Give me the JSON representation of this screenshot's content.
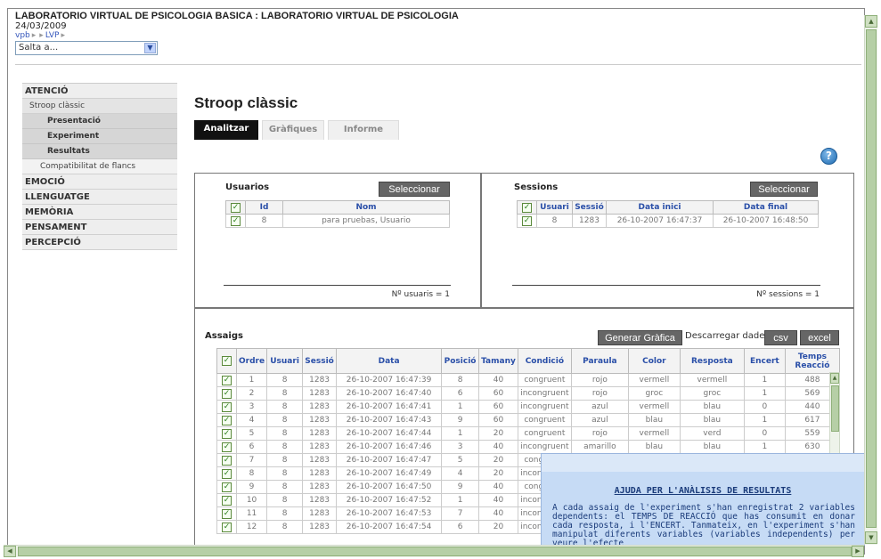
{
  "header": {
    "title": "LABORATORIO VIRTUAL DE PSICOLOGIA BASICA : LABORATORIO VIRTUAL DE PSICOLOGIA",
    "date": "24/03/2009",
    "breadcrumb": [
      "vpb",
      "LVP"
    ],
    "jump_label": "Salta a..."
  },
  "sidebar": {
    "categories": [
      {
        "label": "ATENCIÓ"
      },
      {
        "label": "EMOCIÓ"
      },
      {
        "label": "LLENGUATGE"
      },
      {
        "label": "MEMÒRIA"
      },
      {
        "label": "PENSAMENT"
      },
      {
        "label": "PERCEPCIÓ"
      }
    ],
    "atencio_sub": "Stroop clàssic",
    "atencio_leaves": [
      "Presentació",
      "Experiment",
      "Resultats"
    ],
    "atencio_sub2": "Compatibilitat de flancs"
  },
  "main": {
    "title": "Stroop clàssic",
    "tabs": [
      "Analitzar",
      "Gràfiques",
      "Informe"
    ]
  },
  "usuarios": {
    "title": "Usuarios",
    "select_label": "Seleccionar",
    "headers": [
      "Id",
      "Nom"
    ],
    "rows": [
      [
        "8",
        "para pruebas, Usuario"
      ]
    ],
    "footer": "Nº usuaris = 1"
  },
  "sessions": {
    "title": "Sessions",
    "select_label": "Seleccionar",
    "headers": [
      "Usuari",
      "Sessió",
      "Data inici",
      "Data final"
    ],
    "rows": [
      [
        "8",
        "1283",
        "26-10-2007 16:47:37",
        "26-10-2007 16:48:50"
      ]
    ],
    "footer": "Nº sessions = 1"
  },
  "assaigs": {
    "title": "Assaigs",
    "generate_label": "Generar Gràfica",
    "download_label": "Descarregar dades:",
    "csv_label": "csv",
    "excel_label": "excel",
    "headers": [
      "Ordre",
      "Usuari",
      "Sessió",
      "Data",
      "Posició",
      "Tamany",
      "Condició",
      "Paraula",
      "Color",
      "Resposta",
      "Encert",
      "Temps Reacció"
    ],
    "rows": [
      [
        "1",
        "8",
        "1283",
        "26-10-2007 16:47:39",
        "8",
        "40",
        "congruent",
        "rojo",
        "vermell",
        "vermell",
        "1",
        "488"
      ],
      [
        "2",
        "8",
        "1283",
        "26-10-2007 16:47:40",
        "6",
        "60",
        "incongruent",
        "rojo",
        "groc",
        "groc",
        "1",
        "569"
      ],
      [
        "3",
        "8",
        "1283",
        "26-10-2007 16:47:41",
        "1",
        "60",
        "incongruent",
        "azul",
        "vermell",
        "blau",
        "0",
        "440"
      ],
      [
        "4",
        "8",
        "1283",
        "26-10-2007 16:47:43",
        "9",
        "60",
        "congruent",
        "azul",
        "blau",
        "blau",
        "1",
        "617"
      ],
      [
        "5",
        "8",
        "1283",
        "26-10-2007 16:47:44",
        "1",
        "20",
        "congruent",
        "rojo",
        "vermell",
        "verd",
        "0",
        "559"
      ],
      [
        "6",
        "8",
        "1283",
        "26-10-2007 16:47:46",
        "3",
        "40",
        "incongruent",
        "amarillo",
        "blau",
        "blau",
        "1",
        "630"
      ],
      [
        "7",
        "8",
        "1283",
        "26-10-2007 16:47:47",
        "5",
        "20",
        "congruent",
        "",
        "",
        "",
        "",
        ""
      ],
      [
        "8",
        "8",
        "1283",
        "26-10-2007 16:47:49",
        "4",
        "20",
        "incongruent",
        "",
        "",
        "",
        "",
        ""
      ],
      [
        "9",
        "8",
        "1283",
        "26-10-2007 16:47:50",
        "9",
        "40",
        "congruent",
        "",
        "",
        "",
        "",
        ""
      ],
      [
        "10",
        "8",
        "1283",
        "26-10-2007 16:47:52",
        "1",
        "40",
        "incongruent",
        "",
        "",
        "",
        "",
        ""
      ],
      [
        "11",
        "8",
        "1283",
        "26-10-2007 16:47:53",
        "7",
        "40",
        "incongruent",
        "",
        "",
        "",
        "",
        ""
      ],
      [
        "12",
        "8",
        "1283",
        "26-10-2007 16:47:54",
        "6",
        "20",
        "incongruent",
        "",
        "",
        "",
        "",
        ""
      ]
    ]
  },
  "help": {
    "title": "AJUDA PER L'ANÀLISIS DE RESULTATS",
    "text": "A cada assaig de l'experiment s'han enregistrat 2 variables dependents: el TEMPS DE REACCIÓ que has consumit en donar cada resposta, i l'ENCERT. Tanmateix, en l'experiment s'han manipulat diferents variables (variables independents) per veure l'efecte"
  }
}
